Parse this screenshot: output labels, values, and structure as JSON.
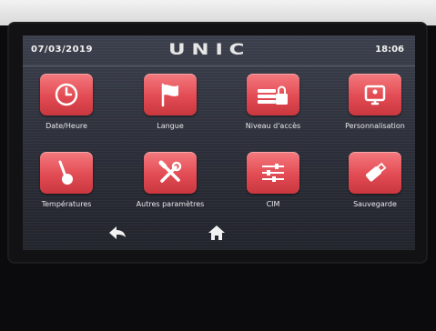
{
  "header": {
    "date": "07/03/2019",
    "logo": "UNIC",
    "time": "18:06"
  },
  "menu": {
    "items": [
      {
        "label": "Date/Heure",
        "icon": "clock-icon"
      },
      {
        "label": "Langue",
        "icon": "flag-icon"
      },
      {
        "label": "Niveau d'accès",
        "icon": "lock-icon"
      },
      {
        "label": "Personnalisation",
        "icon": "monitor-icon"
      },
      {
        "label": "Températures",
        "icon": "thermometer-icon"
      },
      {
        "label": "Autres paramètres",
        "icon": "tools-icon"
      },
      {
        "label": "CIM",
        "icon": "sliders-icon"
      },
      {
        "label": "Sauvegarde",
        "icon": "usb-drive-icon"
      }
    ]
  },
  "footer": {
    "back_icon": "back-arrow-icon",
    "home_icon": "home-icon"
  },
  "colors": {
    "tile_red": "#e24b53",
    "screen_bg": "#2b2e38",
    "text": "#e9e9ec"
  }
}
